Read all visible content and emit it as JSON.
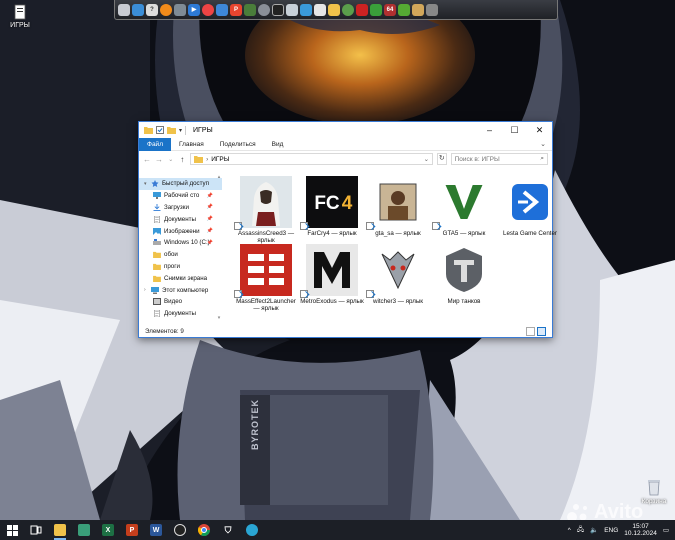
{
  "desktop": {
    "icons": [
      {
        "label": "ИГРЫ",
        "icon": "folder-icon"
      }
    ],
    "recycle_bin": {
      "label": "Корзина",
      "icon": "recycle-bin-icon"
    },
    "watermark": "Avito",
    "helmet_text": "BYROTEK"
  },
  "dock": {
    "items": [
      "monitor-icon",
      "chrome-icon",
      "question-icon",
      "vlc-icon",
      "tool-icon",
      "send-icon",
      "chrome-icon",
      "photos-icon",
      "p-app-icon",
      "game-icon",
      "gear-icon",
      "steam-icon",
      "mail-icon",
      "camera-icon",
      "mail-app-icon",
      "folder-icon",
      "settings-icon",
      "game2-icon",
      "headset-icon",
      "64-app-icon",
      "lightning-icon",
      "map-icon",
      "tools-icon"
    ],
    "badge_text": "64"
  },
  "explorer": {
    "title": "ИГРЫ",
    "ribbon_tabs": [
      "Файл",
      "Главная",
      "Поделиться",
      "Вид"
    ],
    "address": "ИГРЫ",
    "search_placeholder": "Поиск в: ИГРЫ",
    "nav": [
      {
        "label": "Быстрый доступ",
        "icon": "star-icon",
        "top": true,
        "selected": true
      },
      {
        "label": "Рабочий сто",
        "icon": "desktop-icon",
        "pinned": true
      },
      {
        "label": "Загрузки",
        "icon": "download-icon",
        "pinned": true
      },
      {
        "label": "Документы",
        "icon": "documents-icon",
        "pinned": true
      },
      {
        "label": "Изображени",
        "icon": "pictures-icon",
        "pinned": true
      },
      {
        "label": "Windows 10 (C:)",
        "icon": "drive-icon",
        "pinned": true
      },
      {
        "label": "обои",
        "icon": "folder-icon"
      },
      {
        "label": "проги",
        "icon": "folder-icon"
      },
      {
        "label": "Снимки экрана",
        "icon": "folder-icon"
      },
      {
        "label": "Этот компьютер",
        "icon": "pc-icon",
        "top": true
      },
      {
        "label": "Видео",
        "icon": "video-icon"
      },
      {
        "label": "Документы",
        "icon": "documents-icon"
      }
    ],
    "files": [
      {
        "label": "AssassinsCreed3 — ярлык",
        "icon": "assassins-creed-icon"
      },
      {
        "label": "FarCry4 — ярлык",
        "icon": "farcry4-icon",
        "badge": "FC4"
      },
      {
        "label": "gta_sa — ярлык",
        "icon": "gta-sa-icon"
      },
      {
        "label": "GTA5 — ярлык",
        "icon": "gta5-icon"
      },
      {
        "label": "Lesta Game Center",
        "icon": "lesta-icon"
      },
      {
        "label": "MassEffect2Launcher — ярлык",
        "icon": "mass-effect-icon"
      },
      {
        "label": "MetroExodus — ярлык",
        "icon": "metro-icon",
        "badge": "M"
      },
      {
        "label": "witcher3 — ярлык",
        "icon": "witcher-icon"
      },
      {
        "label": "Мир танков",
        "icon": "tanks-icon"
      }
    ],
    "status": "Элементов: 9"
  },
  "taskbar": {
    "items": [
      "windows-icon",
      "task-view-icon",
      "explorer-icon",
      "calculator-icon",
      "excel-icon",
      "powerpoint-icon",
      "word-icon",
      "obs-icon",
      "chrome-icon",
      "windows-security-icon",
      "settings-icon"
    ],
    "language": "ENG",
    "time": "15:07",
    "date": "10.12.2024"
  }
}
